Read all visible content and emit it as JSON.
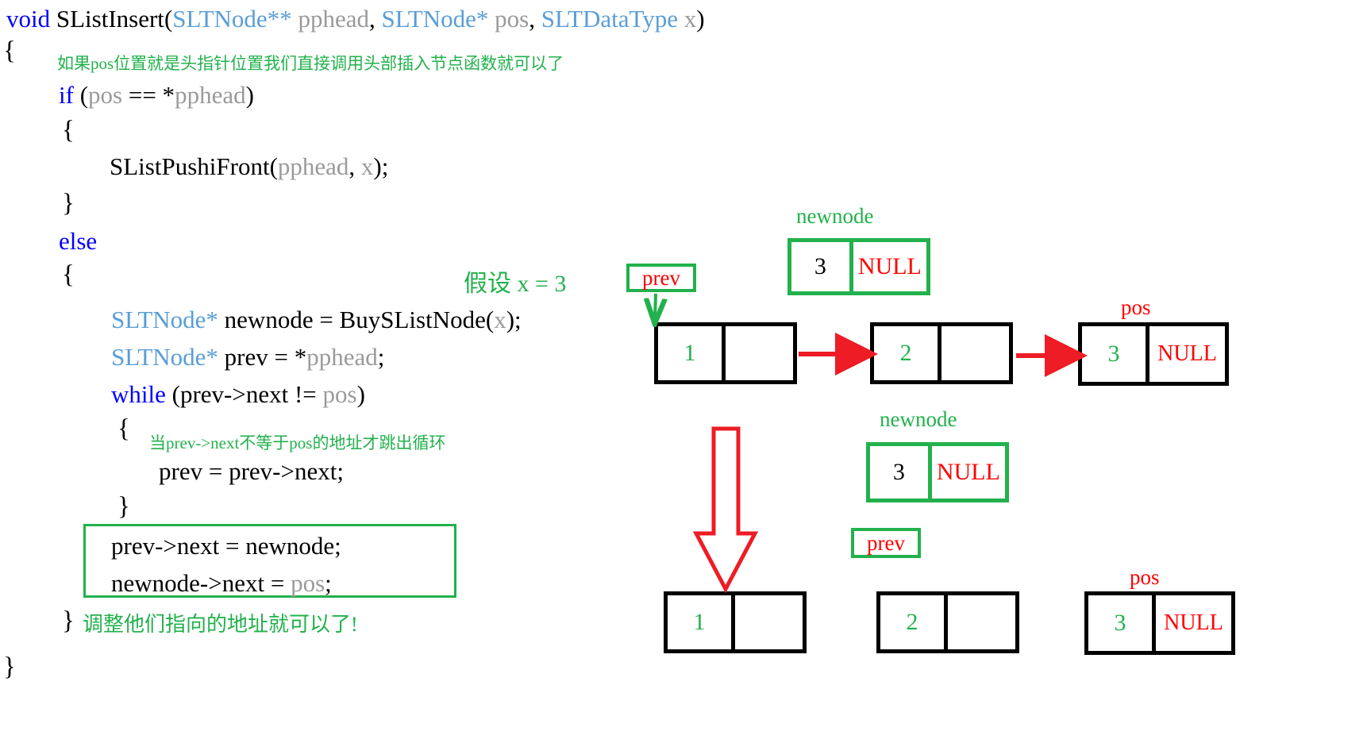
{
  "code": {
    "language": "c",
    "lines": [
      {
        "id": "signature",
        "segments": [
          {
            "text": "void ",
            "style": "kw"
          },
          {
            "text": "SListInsert",
            "style": "plain"
          },
          {
            "text": "(",
            "style": "plain"
          },
          {
            "text": "SLTNode**",
            "style": "type"
          },
          {
            "text": " pphead",
            "style": "dim"
          },
          {
            "text": ", ",
            "style": "plain"
          },
          {
            "text": "SLTNode*",
            "style": "type"
          },
          {
            "text": " pos",
            "style": "dim"
          },
          {
            "text": ", ",
            "style": "plain"
          },
          {
            "text": "SLTDataType",
            "style": "type"
          },
          {
            "text": " x",
            "style": "dim"
          },
          {
            "text": ")",
            "style": "plain"
          }
        ]
      }
    ],
    "brace_open_outer": "{",
    "brace_close_outer": "}",
    "comment_1": "如果pos位置就是头指针位置我们直接调用头部插入节点函数就可以了",
    "if_line_kw": "if",
    "if_line_cond_open": " (",
    "if_line_pos": "pos",
    "if_line_eq": " == *",
    "if_line_pphead": "pphead",
    "if_line_close": ")",
    "brace_open_if": "{",
    "call_push_front": "SListPushiFront",
    "call_push_front_open": "(",
    "call_push_front_arg1": "pphead",
    "call_push_front_comma": ", ",
    "call_push_front_arg2": "x",
    "call_push_front_close": ");",
    "brace_close_if": "}",
    "else_kw": "else",
    "brace_open_else": "{",
    "decl_newnode_type": "SLTNode*",
    "decl_newnode_rest": " newnode = BuySListNode(",
    "decl_newnode_arg": "x",
    "decl_newnode_close": ");",
    "decl_prev_type": "SLTNode*",
    "decl_prev_rest": " prev = *",
    "decl_prev_pphead": "pphead",
    "decl_prev_semi": ";",
    "while_kw": "while",
    "while_cond_open": " (prev->next != ",
    "while_cond_pos": "pos",
    "while_cond_close": ")",
    "brace_open_while": "{",
    "comment_2": "当prev->next不等于pos的地址才跳出循环",
    "while_body": "prev = prev->next;",
    "brace_close_while": "}",
    "boxed_line_1": "prev->next = newnode;",
    "boxed_line_2_a": "newnode->next = ",
    "boxed_line_2_pos": "pos",
    "boxed_line_2_semi": ";",
    "brace_close_else": "}",
    "comment_3": "调整他们指向的地址就可以了!"
  },
  "diagram": {
    "assumption_text": "假设 x = 3",
    "stage_top": {
      "newnode_label": "newnode",
      "newnode_data": "3",
      "newnode_next": "NULL",
      "prev_pointer_label": "prev",
      "pos_label": "pos",
      "list_nodes": [
        {
          "data": "1",
          "next": ""
        },
        {
          "data": "2",
          "next": ""
        },
        {
          "data": "3",
          "next": "NULL"
        }
      ]
    },
    "stage_bottom": {
      "newnode_label": "newnode",
      "newnode_data": "3",
      "newnode_next": "NULL",
      "newnode_next_crossed": true,
      "prev_pointer_label": "prev",
      "pos_label": "pos",
      "list_nodes": [
        {
          "data": "1",
          "next": ""
        },
        {
          "data": "2",
          "next": ""
        },
        {
          "data": "3",
          "next": "NULL"
        }
      ]
    }
  },
  "colors": {
    "keyword_blue": "#0000ff",
    "type_blue": "#5a9ed6",
    "dim_gray": "#9a9a9a",
    "comment_green": "#22b14c",
    "pointer_red": "#ff0000",
    "node_black": "#000000"
  }
}
